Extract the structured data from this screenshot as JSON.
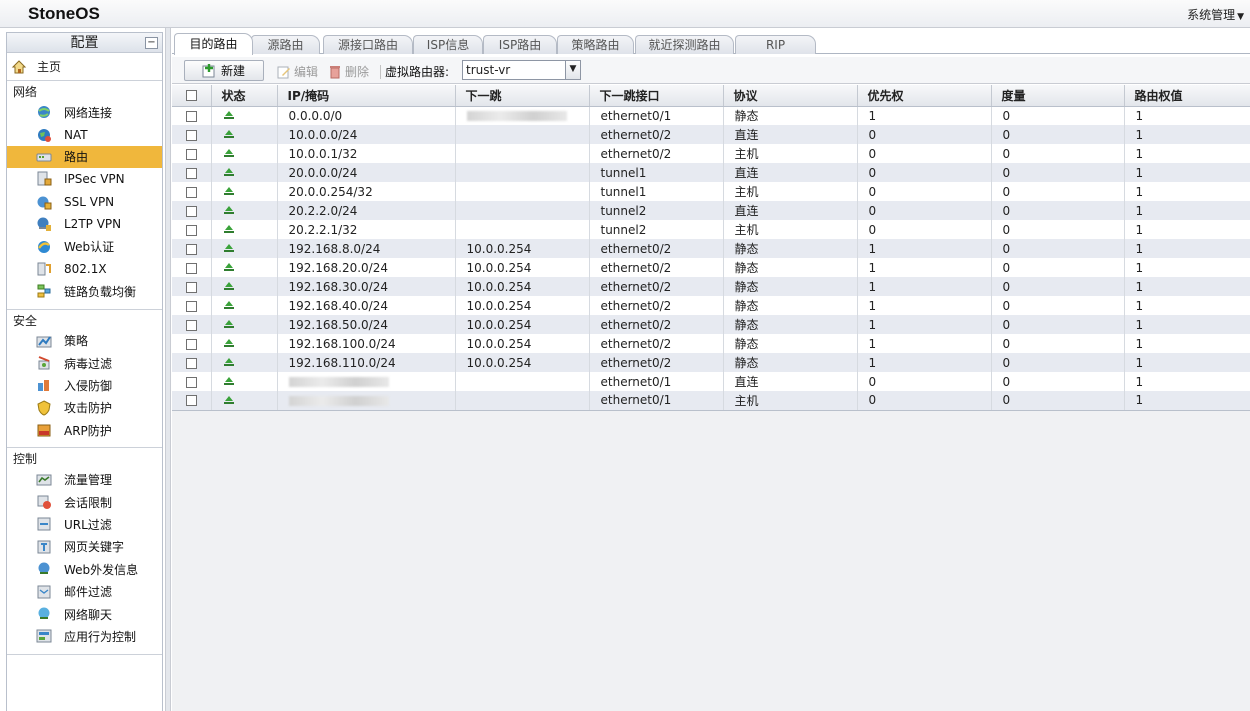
{
  "app": {
    "logo": "StoneOS",
    "system_menu": "系统管理"
  },
  "sidebar": {
    "title": "配置",
    "collapse": "−",
    "home": "主页",
    "sections": [
      {
        "title": "网络",
        "items": [
          {
            "label": "网络连接",
            "icon": "network-globe-icon"
          },
          {
            "label": "NAT",
            "icon": "nat-globe-icon"
          },
          {
            "label": "路由",
            "icon": "router-icon",
            "active": true
          },
          {
            "label": "IPSec VPN",
            "icon": "ipsec-vpn-icon"
          },
          {
            "label": "SSL VPN",
            "icon": "ssl-vpn-icon"
          },
          {
            "label": "L2TP VPN",
            "icon": "l2tp-vpn-icon"
          },
          {
            "label": "Web认证",
            "icon": "web-auth-icon"
          },
          {
            "label": "802.1X",
            "icon": "dot1x-icon"
          },
          {
            "label": "链路负载均衡",
            "icon": "link-balance-icon"
          }
        ]
      },
      {
        "title": "安全",
        "items": [
          {
            "label": "策略",
            "icon": "policy-icon"
          },
          {
            "label": "病毒过滤",
            "icon": "antivirus-icon"
          },
          {
            "label": "入侵防御",
            "icon": "ips-icon"
          },
          {
            "label": "攻击防护",
            "icon": "shield-icon"
          },
          {
            "label": "ARP防护",
            "icon": "arp-icon"
          }
        ]
      },
      {
        "title": "控制",
        "items": [
          {
            "label": "流量管理",
            "icon": "traffic-icon"
          },
          {
            "label": "会话限制",
            "icon": "session-limit-icon"
          },
          {
            "label": "URL过滤",
            "icon": "url-filter-icon"
          },
          {
            "label": "网页关键字",
            "icon": "keyword-icon"
          },
          {
            "label": "Web外发信息",
            "icon": "web-post-icon"
          },
          {
            "label": "邮件过滤",
            "icon": "mail-filter-icon"
          },
          {
            "label": "网络聊天",
            "icon": "im-icon"
          },
          {
            "label": "应用行为控制",
            "icon": "app-control-icon"
          }
        ]
      }
    ]
  },
  "tabs": [
    "目的路由",
    "源路由",
    "源接口路由",
    "ISP信息",
    "ISP路由",
    "策略路由",
    "就近探测路由",
    "RIP"
  ],
  "toolbar": {
    "new": "新建",
    "edit": "编辑",
    "delete": "删除",
    "vr_label": "虚拟路由器:",
    "vr_value": "trust-vr"
  },
  "table": {
    "columns": [
      "",
      "状态",
      "IP/掩码",
      "下一跳",
      "下一跳接口",
      "协议",
      "优先权",
      "度量",
      "路由权值"
    ],
    "rows": [
      {
        "ip": "0.0.0.0/0",
        "next_hop": "",
        "next_hop_masked": true,
        "iface": "ethernet0/1",
        "proto": "静态",
        "pref": "1",
        "metric": "0",
        "weight": "1"
      },
      {
        "ip": "10.0.0.0/24",
        "next_hop": "",
        "iface": "ethernet0/2",
        "proto": "直连",
        "pref": "0",
        "metric": "0",
        "weight": "1"
      },
      {
        "ip": "10.0.0.1/32",
        "next_hop": "",
        "iface": "ethernet0/2",
        "proto": "主机",
        "pref": "0",
        "metric": "0",
        "weight": "1"
      },
      {
        "ip": "20.0.0.0/24",
        "next_hop": "",
        "iface": "tunnel1",
        "proto": "直连",
        "pref": "0",
        "metric": "0",
        "weight": "1"
      },
      {
        "ip": "20.0.0.254/32",
        "next_hop": "",
        "iface": "tunnel1",
        "proto": "主机",
        "pref": "0",
        "metric": "0",
        "weight": "1"
      },
      {
        "ip": "20.2.2.0/24",
        "next_hop": "",
        "iface": "tunnel2",
        "proto": "直连",
        "pref": "0",
        "metric": "0",
        "weight": "1"
      },
      {
        "ip": "20.2.2.1/32",
        "next_hop": "",
        "iface": "tunnel2",
        "proto": "主机",
        "pref": "0",
        "metric": "0",
        "weight": "1"
      },
      {
        "ip": "192.168.8.0/24",
        "next_hop": "10.0.0.254",
        "iface": "ethernet0/2",
        "proto": "静态",
        "pref": "1",
        "metric": "0",
        "weight": "1"
      },
      {
        "ip": "192.168.20.0/24",
        "next_hop": "10.0.0.254",
        "iface": "ethernet0/2",
        "proto": "静态",
        "pref": "1",
        "metric": "0",
        "weight": "1"
      },
      {
        "ip": "192.168.30.0/24",
        "next_hop": "10.0.0.254",
        "iface": "ethernet0/2",
        "proto": "静态",
        "pref": "1",
        "metric": "0",
        "weight": "1"
      },
      {
        "ip": "192.168.40.0/24",
        "next_hop": "10.0.0.254",
        "iface": "ethernet0/2",
        "proto": "静态",
        "pref": "1",
        "metric": "0",
        "weight": "1"
      },
      {
        "ip": "192.168.50.0/24",
        "next_hop": "10.0.0.254",
        "iface": "ethernet0/2",
        "proto": "静态",
        "pref": "1",
        "metric": "0",
        "weight": "1"
      },
      {
        "ip": "192.168.100.0/24",
        "next_hop": "10.0.0.254",
        "iface": "ethernet0/2",
        "proto": "静态",
        "pref": "1",
        "metric": "0",
        "weight": "1"
      },
      {
        "ip": "192.168.110.0/24",
        "next_hop": "10.0.0.254",
        "iface": "ethernet0/2",
        "proto": "静态",
        "pref": "1",
        "metric": "0",
        "weight": "1"
      },
      {
        "ip": "",
        "ip_masked": true,
        "next_hop": "",
        "iface": "ethernet0/1",
        "proto": "直连",
        "pref": "0",
        "metric": "0",
        "weight": "1"
      },
      {
        "ip": "",
        "ip_masked": true,
        "next_hop": "",
        "iface": "ethernet0/1",
        "proto": "主机",
        "pref": "0",
        "metric": "0",
        "weight": "1"
      }
    ]
  }
}
